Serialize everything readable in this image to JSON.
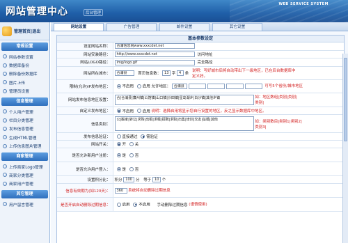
{
  "header": {
    "title": "网站管理中心",
    "subtitle": "后台管理",
    "service": "WEB SERVICE SYSTEM"
  },
  "sidebar": {
    "top_label": "管理首页|退出",
    "sections": [
      {
        "title": "常规设置",
        "items": [
          "网站参数设置",
          "数据库备份",
          "删除备份数据库",
          "图片上传",
          "管理员设置"
        ]
      },
      {
        "title": "信息管理",
        "items": [
          "个人用户管理",
          "栏目分类管理",
          "发布信息管理",
          "生成HTML管理",
          "上传信息图片管理"
        ]
      },
      {
        "title": "商家管理",
        "items": [
          "上传商家Logo管理",
          "商家分类管理",
          "商家用户管理"
        ]
      },
      {
        "title": "其它管理",
        "items": [
          "用户留言管理"
        ]
      }
    ]
  },
  "tabs": [
    "网站设置",
    "广告管理",
    "邮件设置",
    "其它设置"
  ],
  "panel": {
    "title": "基本参数设定",
    "rows": {
      "site_name": {
        "label": "设定网站名称：",
        "value": "合浦信息网www.xxxcdet.net"
      },
      "site_url": {
        "label": "网站安装路径：",
        "value": "http://www.xxxcdet.net",
        "hint": "访问地址"
      },
      "logo_path": {
        "label": "网站LOGO路径：",
        "value": "img/logo.gif",
        "hint": "完全路径"
      },
      "city": {
        "label": "网站所在城市：",
        "city_value": "合浦县",
        "chars_label": "首页信息数：",
        "chars_value": "13",
        "unit": "字",
        "num_value": "4",
        "num_label": "条",
        "note": "说明：写好城市后将自动带出下一级地区，已在后台数据库中定义好。"
      },
      "ip_limit": {
        "label": "限制(允许)IP发布地区：",
        "opt_no": "不启用",
        "opt_yes": "启用",
        "allow_label": "允许地区：",
        "allow_value": "合浦县",
        "note": "可写5个省份/城市地区"
      },
      "publish_area": {
        "label": "网站发布信息地区设置：",
        "value": "合|合浦县|廉州镇|公馆镇|山口镇|沙田镇|星岛湖乡|白沙镇|其他乡镇",
        "note": "如：地区数组|类别|类别|类别|"
      },
      "custom_tag": {
        "label": "自定义发布地区：",
        "opt_no": "不启用",
        "opt_yes": "启用",
        "note": "说明：选择启用将显示您自行设置的地区，反之显示数据库中地区。"
      },
      "info_type": {
        "label": "信息类别：",
        "value": "公|搬家|转让|求购|出租|求租|招聘|求职|出售|培训|交友|征婚|其他",
        "note": "如：类别数目|类别1|类别2|类别3|"
      },
      "publish_review": {
        "label": "发布信息验证：",
        "opt_a": "直接通过",
        "opt_b": "需验证"
      },
      "site_switch": {
        "label": "网站开关：",
        "opt_on": "开",
        "opt_off": "关"
      },
      "reg_verify": {
        "label": "是否允许新用户注册：",
        "opt_yes": "是",
        "opt_no": "否"
      },
      "user_pub": {
        "label": "是否允许用户登入：",
        "opt_yes": "是",
        "opt_no": "否"
      },
      "traffic": {
        "label": "设置积分比：",
        "points_label": "积分",
        "points_value": "100",
        "per_label": "分",
        "money_label": "等于",
        "money_value": "10",
        "money_unit": "个"
      },
      "expire": {
        "label": "信息有效期为(如120天)：",
        "value": "360",
        "note": "系统将自动删除过期信息"
      },
      "auto_delete": {
        "label": "是否开启自动删除过期信息：",
        "opt_yes": "启用",
        "opt_no": "不启用",
        "note_a": "手动删除过期信息",
        "note_b": "(谨慎使用)"
      }
    }
  }
}
